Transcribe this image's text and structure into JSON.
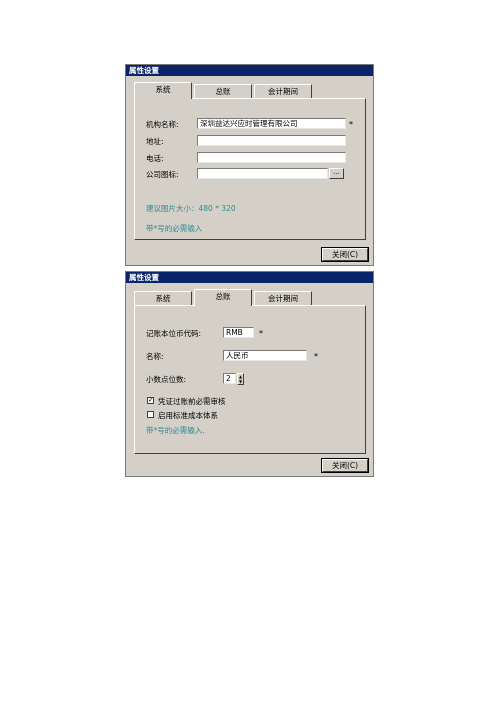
{
  "dialog1": {
    "title": "属性设置",
    "tabs": [
      "系统",
      "总账",
      "会计期间"
    ],
    "fields": {
      "org_name": {
        "label": "机构名称:",
        "value": "深圳益达兴应时管理有限公司"
      },
      "address": {
        "label": "地址:",
        "value": ""
      },
      "phone": {
        "label": "电话:",
        "value": ""
      },
      "logo": {
        "label": "公司图标:",
        "value": ""
      }
    },
    "browse_label": "...",
    "required_mark": "*",
    "hint_image": "建议图片大小：480 * 320",
    "hint_required": "带*号的必需输入",
    "close_label": "关闭(C)"
  },
  "dialog2": {
    "title": "属性设置",
    "tabs": [
      "系统",
      "总账",
      "会计期间"
    ],
    "fields": {
      "currency_code": {
        "label": "记账本位币代码:",
        "value": "RMB"
      },
      "currency_name": {
        "label": "名称:",
        "value": "人民币"
      },
      "decimals": {
        "label": "小数点位数:",
        "value": "2"
      }
    },
    "required_mark": "*",
    "checkboxes": [
      {
        "label": "凭证过账前必需审核",
        "checked": true
      },
      {
        "label": "启用标准成本体系",
        "checked": false
      }
    ],
    "hint_required": "带*号的必需输入.",
    "close_label": "关闭(C)"
  }
}
